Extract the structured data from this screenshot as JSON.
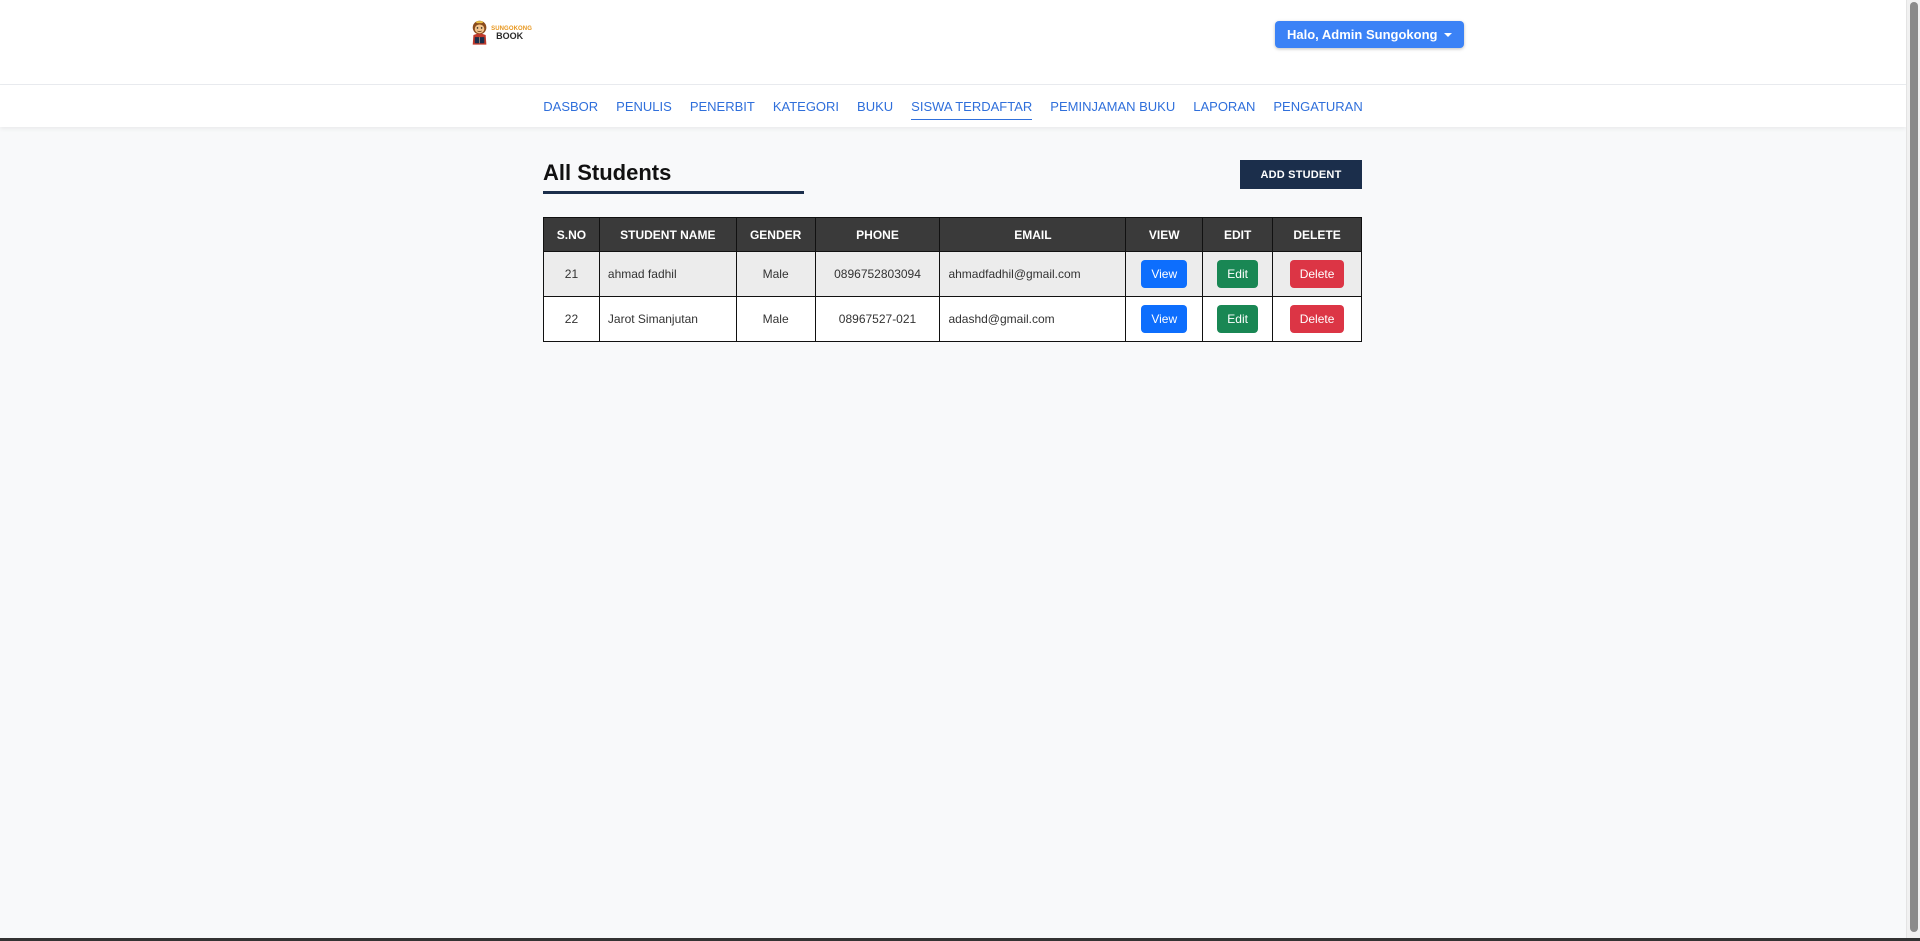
{
  "brand": {
    "line1": "SUNGOKONG",
    "line2": "BOOK"
  },
  "user_menu": {
    "label": "Halo, Admin Sungokong"
  },
  "nav": {
    "items": [
      {
        "label": "DASBOR"
      },
      {
        "label": "PENULIS"
      },
      {
        "label": "PENERBIT"
      },
      {
        "label": "KATEGORI"
      },
      {
        "label": "BUKU"
      },
      {
        "label": "SISWA TERDAFTAR",
        "active": true
      },
      {
        "label": "PEMINJAMAN BUKU"
      },
      {
        "label": "LAPORAN"
      },
      {
        "label": "PENGATURAN"
      }
    ]
  },
  "main": {
    "title": "All Students",
    "add_button": "ADD STUDENT",
    "table": {
      "headers": [
        "S.NO",
        "STUDENT NAME",
        "GENDER",
        "PHONE",
        "EMAIL",
        "VIEW",
        "EDIT",
        "DELETE"
      ],
      "rows": [
        {
          "sno": "21",
          "name": "ahmad fadhil",
          "gender": "Male",
          "phone": "0896752803094",
          "email": "ahmadfadhil@gmail.com",
          "view": "View",
          "edit": "Edit",
          "delete": "Delete"
        },
        {
          "sno": "22",
          "name": "Jarot Simanjutan",
          "gender": "Male",
          "phone": "08967527-021",
          "email": "adashd@gmail.com",
          "view": "View",
          "edit": "Edit",
          "delete": "Delete"
        }
      ]
    }
  },
  "colors": {
    "accent": "#3b82f6",
    "nav_link": "#2f6fdb",
    "dark_navy": "#1b2e4b",
    "view": "#0d6efd",
    "edit": "#198754",
    "delete": "#dc3545"
  }
}
